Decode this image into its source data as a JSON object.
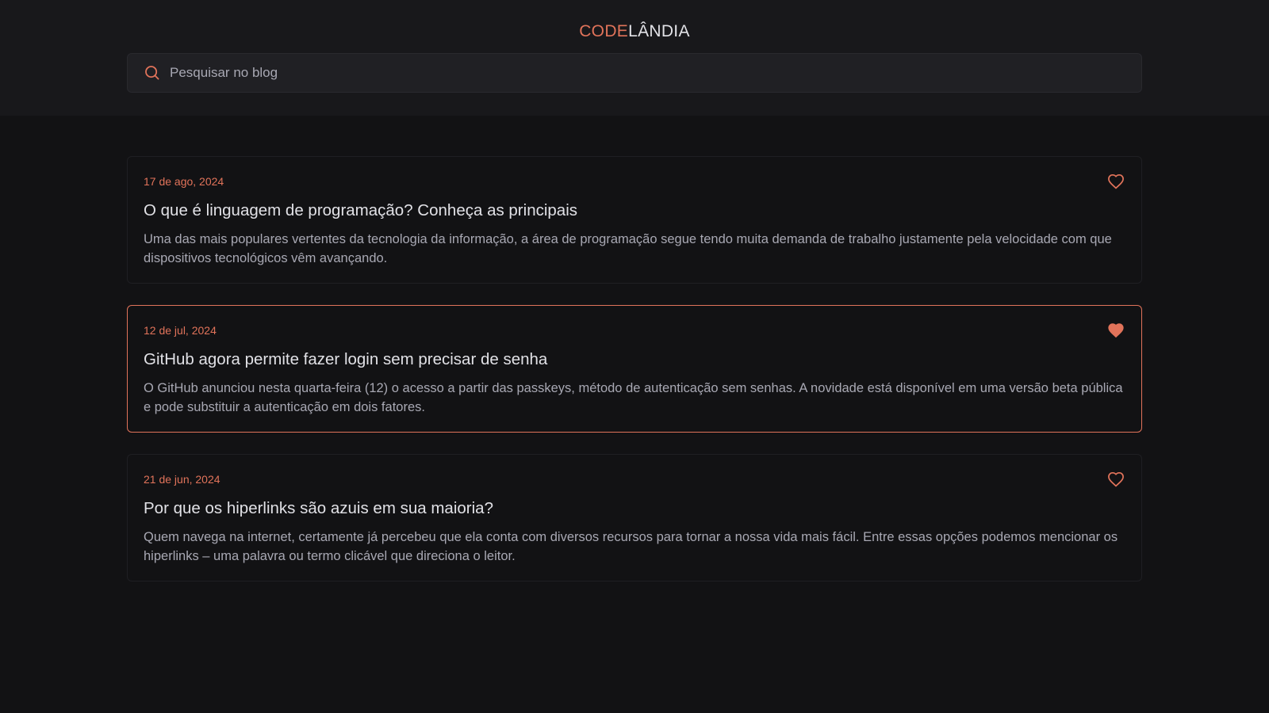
{
  "header": {
    "logo": {
      "part1": "CODE",
      "part2": "LÂNDIA"
    },
    "search": {
      "placeholder": "Pesquisar no blog",
      "value": ""
    }
  },
  "colors": {
    "accent": "#e1735a",
    "background": "#121214",
    "header_background": "#18181b",
    "title": "#e1e1e6",
    "text": "#a8a8b3"
  },
  "posts": [
    {
      "date": "17 de ago, 2024",
      "title": "O que é linguagem de programação? Conheça as principais",
      "excerpt": "Uma das mais populares vertentes da tecnologia da informação, a área de programação segue tendo muita demanda de trabalho justamente pela velocidade com que dispositivos tecnológicos vêm avançando.",
      "liked": false,
      "like_icon": "heart-outline-icon"
    },
    {
      "date": "12 de jul, 2024",
      "title": "GitHub agora permite fazer login sem precisar de senha",
      "excerpt": "O GitHub anunciou nesta quarta-feira (12) o acesso a partir das passkeys, método de autenticação sem senhas. A novidade está disponível em uma versão beta pública e pode substituir a autenticação em dois fatores.",
      "liked": true,
      "like_icon": "heart-filled-icon"
    },
    {
      "date": "21 de jun, 2024",
      "title": "Por que os hiperlinks são azuis em sua maioria?",
      "excerpt": "Quem navega na internet, certamente já percebeu que ela conta com diversos recursos para tornar a nossa vida mais fácil. Entre essas opções podemos mencionar os hiperlinks – uma palavra ou termo clicável que direciona o leitor.",
      "liked": false,
      "like_icon": "heart-outline-icon"
    }
  ]
}
